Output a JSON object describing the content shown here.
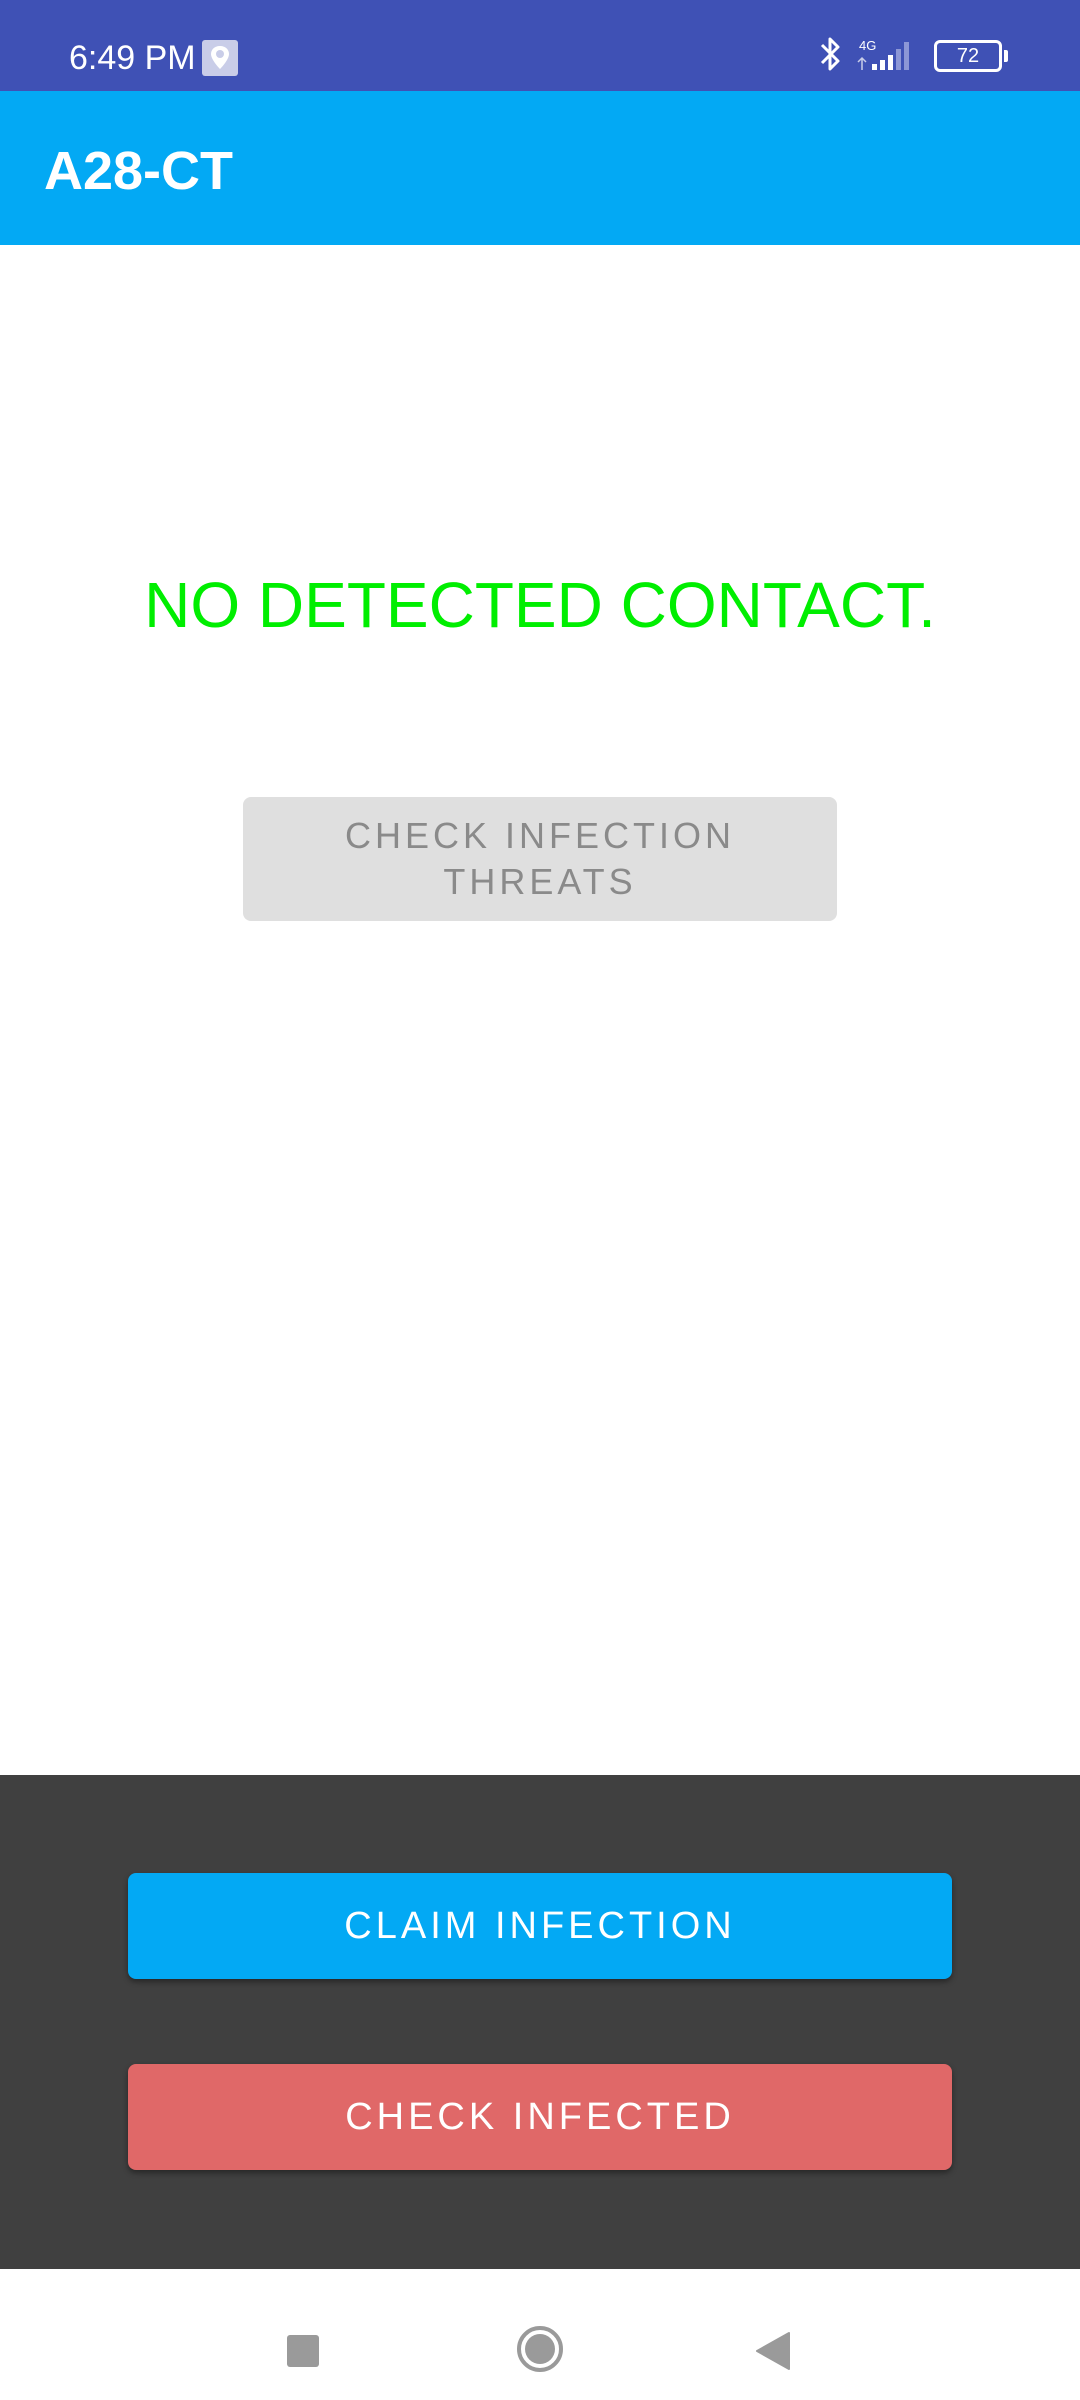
{
  "status_bar": {
    "time": "6:49 PM",
    "network": "4G",
    "battery": "72",
    "icons": [
      "location-icon",
      "bluetooth-icon",
      "signal-icon",
      "battery-icon"
    ]
  },
  "app_bar": {
    "title": "A28-CT"
  },
  "main": {
    "status_message": "NO DETECTED CONTACT.",
    "check_threats_label": "CHECK INFECTION THREATS"
  },
  "bottom_panel": {
    "claim_label": "CLAIM INFECTION",
    "check_infected_label": "CHECK INFECTED"
  },
  "nav_bar": {
    "icons": [
      "recent-apps-icon",
      "home-icon",
      "back-icon"
    ]
  },
  "colors": {
    "status_bar": "#3f51b5",
    "app_bar": "#03a9f4",
    "status_message": "#00ee00",
    "claim_button": "#03a9f4",
    "check_infected_button": "#e06868",
    "bottom_panel": "#404040"
  }
}
